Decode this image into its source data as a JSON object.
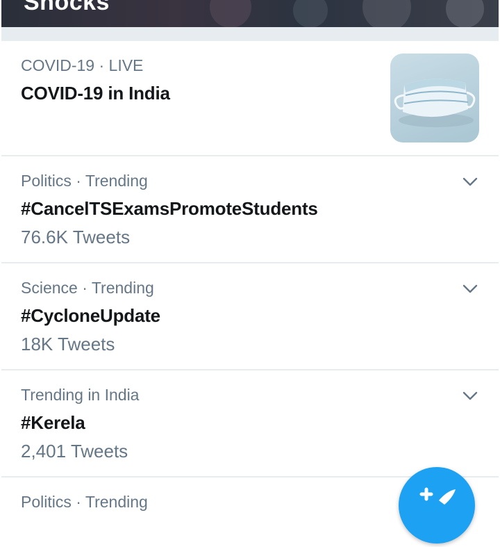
{
  "header": {
    "title": "Shocks"
  },
  "trends": [
    {
      "meta": "COVID-19 · LIVE",
      "headline": "COVID-19 in India",
      "has_thumb": true
    },
    {
      "meta": "Politics · Trending",
      "headline": "#CancelTSExamsPromoteStudents",
      "count": "76.6K Tweets"
    },
    {
      "meta": "Science · Trending",
      "headline": "#CycloneUpdate",
      "count": "18K Tweets"
    },
    {
      "meta": "Trending in India",
      "headline": "#Kerela",
      "count": "2,401 Tweets"
    },
    {
      "meta": "Politics · Trending"
    }
  ],
  "icons": {
    "more": "chevron-down-icon",
    "compose": "compose-tweet-icon",
    "thumbnail": "face-mask-image"
  },
  "colors": {
    "accent": "#1da1f2",
    "secondary_text": "#657786",
    "primary_text": "#14171a",
    "divider": "#e6ecf0"
  }
}
